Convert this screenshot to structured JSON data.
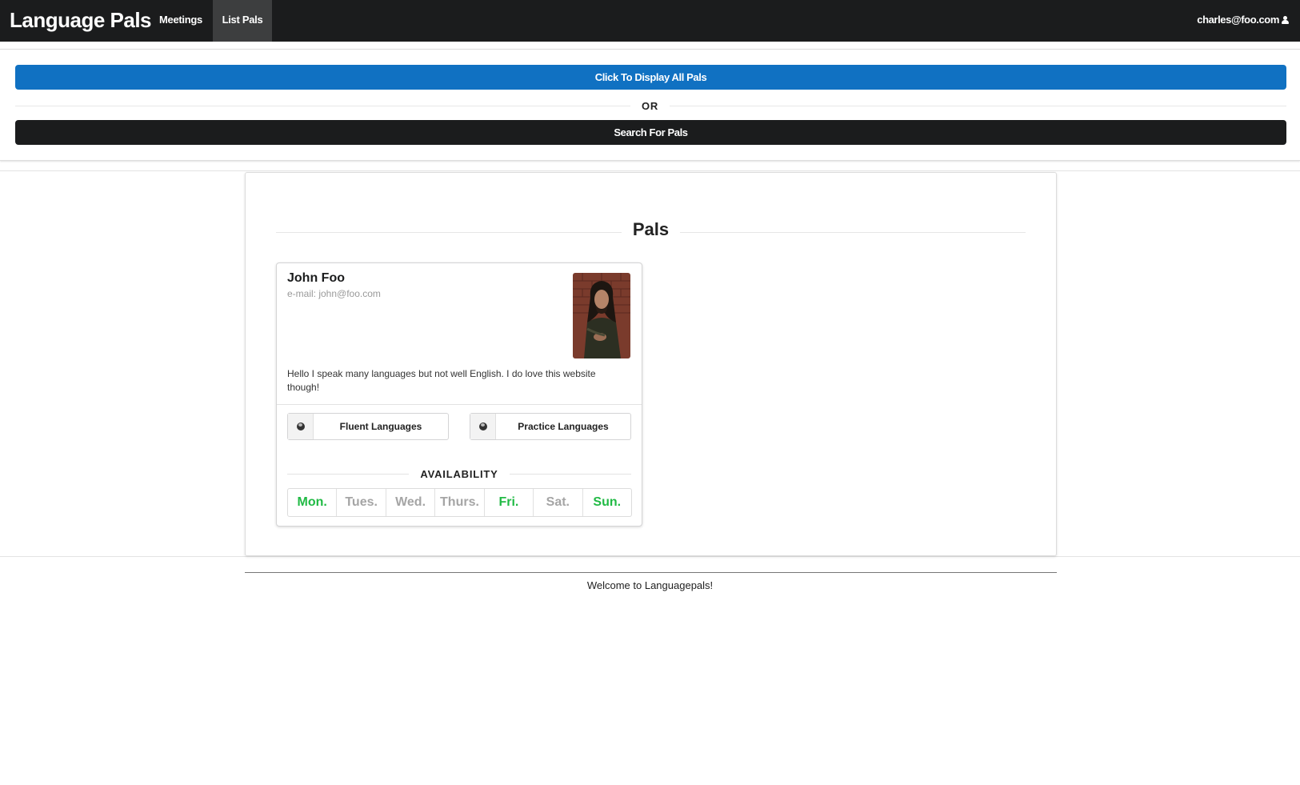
{
  "navbar": {
    "brand": "Language Pals",
    "items": [
      {
        "label": "Meetings"
      },
      {
        "label": "List Pals",
        "active": true
      }
    ],
    "user_email": "charles@foo.com",
    "user_icon": "user-icon"
  },
  "actions": {
    "display_all_label": "Click To Display All Pals",
    "or_label": "OR",
    "search_label": "Search For Pals"
  },
  "colors": {
    "primary_blue": "#1071c2",
    "navbar_black": "#1b1c1d",
    "available_green": "#21ba45",
    "unavailable_gray": "#a5a5a5"
  },
  "pals": {
    "heading": "Pals",
    "cards": [
      {
        "name": "John Foo",
        "email_line": "e-mail: john@foo.com",
        "bio": "Hello I speak many languages but not well English. I do love this website though!",
        "fluent_label": "Fluent Languages",
        "practice_label": "Practice Languages",
        "availability_heading": "AVAILABILITY",
        "days": [
          {
            "label": "Mon.",
            "available": true
          },
          {
            "label": "Tues.",
            "available": false
          },
          {
            "label": "Wed.",
            "available": false
          },
          {
            "label": "Thurs.",
            "available": false
          },
          {
            "label": "Fri.",
            "available": true
          },
          {
            "label": "Sat.",
            "available": false
          },
          {
            "label": "Sun.",
            "available": true
          }
        ]
      }
    ]
  },
  "footer": {
    "text": "Welcome to Languagepals!"
  }
}
